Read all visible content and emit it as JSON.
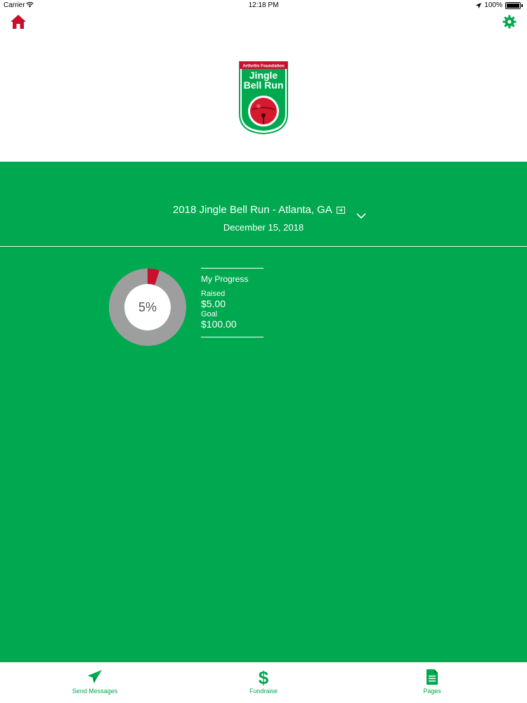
{
  "status_bar": {
    "carrier": "Carrier",
    "time": "12:18 PM",
    "battery": "100%"
  },
  "colors": {
    "brand_green": "#00a94f",
    "accent_red": "#c8102e",
    "donut_track": "#9e9e9e"
  },
  "header": {
    "home_icon": "home-icon",
    "settings_icon": "gear-icon",
    "logo": {
      "org": "Arthritis Foundation",
      "line1": "Jingle",
      "line2": "Bell Run"
    }
  },
  "event": {
    "title": "2018 Jingle Bell Run - Atlanta, GA",
    "date": "December 15, 2018"
  },
  "progress": {
    "heading": "My Progress",
    "raised_label": "Raised",
    "raised_value": "$5.00",
    "goal_label": "Goal",
    "goal_value": "$100.00",
    "percent_label": "5%",
    "fraction": 0.05
  },
  "tabs": [
    {
      "label": "Send Messages",
      "icon": "paper-plane-icon"
    },
    {
      "label": "Fundraise",
      "icon": "dollar-icon"
    },
    {
      "label": "Pages",
      "icon": "document-icon"
    }
  ]
}
